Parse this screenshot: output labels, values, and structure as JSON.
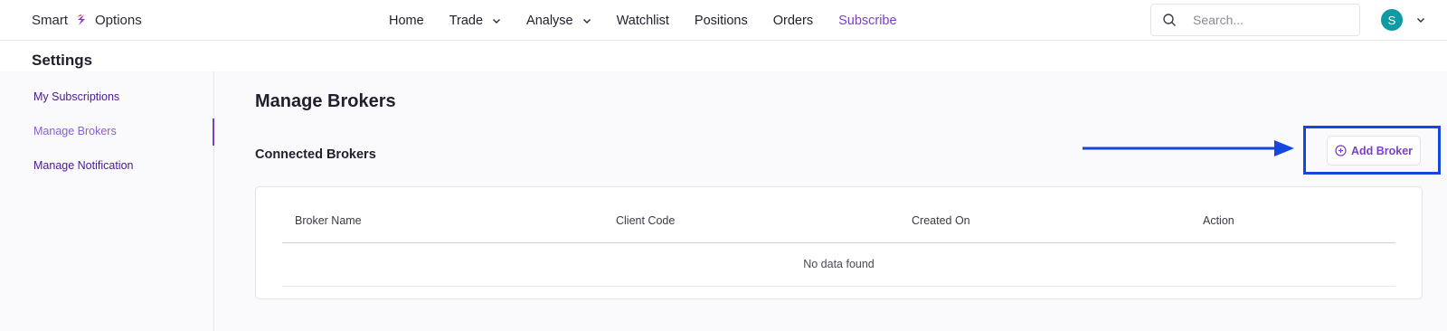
{
  "brand": {
    "name_left": "Smart",
    "name_right": "Options"
  },
  "nav": [
    {
      "label": "Home",
      "dropdown": false
    },
    {
      "label": "Trade",
      "dropdown": true
    },
    {
      "label": "Analyse",
      "dropdown": true
    },
    {
      "label": "Watchlist",
      "dropdown": false
    },
    {
      "label": "Positions",
      "dropdown": false
    },
    {
      "label": "Orders",
      "dropdown": false
    },
    {
      "label": "Subscribe",
      "dropdown": false,
      "active": true
    }
  ],
  "search": {
    "placeholder": "Search..."
  },
  "user": {
    "initial": "S",
    "avatar_color": "#0f9aa4"
  },
  "settings": {
    "title": "Settings"
  },
  "sidebar": {
    "items": [
      {
        "label": "My Subscriptions"
      },
      {
        "label": "Manage Brokers",
        "active": true
      },
      {
        "label": "Manage Notification"
      }
    ]
  },
  "main": {
    "title": "Manage Brokers",
    "section_title": "Connected Brokers",
    "add_button": "Add Broker",
    "table": {
      "columns": [
        "Broker Name",
        "Client Code",
        "Created On",
        "Action"
      ],
      "empty_text": "No data found"
    }
  },
  "colors": {
    "accent": "#7c3fc8",
    "highlight": "#1446e0"
  }
}
